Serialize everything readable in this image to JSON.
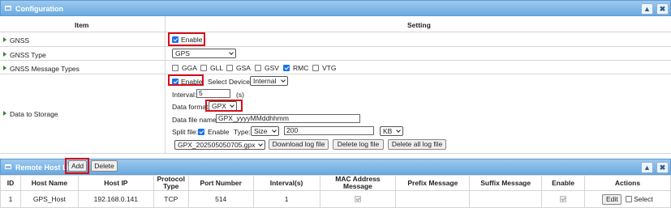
{
  "config": {
    "title": "Configuration",
    "col_item": "Item",
    "col_setting": "Setting",
    "minimize": "▲",
    "close": "✖",
    "gnss": {
      "label": "GNSS",
      "enable_label": "Enable",
      "enabled": true
    },
    "gnss_type": {
      "label": "GNSS Type",
      "value": "GPS"
    },
    "msg_types": {
      "label": "GNSS Message Types",
      "options": [
        {
          "label": "GGA",
          "checked": false
        },
        {
          "label": "GLL",
          "checked": false
        },
        {
          "label": "GSA",
          "checked": false
        },
        {
          "label": "GSV",
          "checked": false
        },
        {
          "label": "RMC",
          "checked": true
        },
        {
          "label": "VTG",
          "checked": false
        }
      ]
    },
    "storage": {
      "label": "Data to Storage",
      "enable_label": "Enable",
      "select_device_label": "Select Device:",
      "device": "Internal",
      "interval_label": "Interval:",
      "interval": "5",
      "interval_unit": "(s)",
      "format_label": "Data format:",
      "format": "GPX",
      "filename_label": "Data file name:",
      "filename": "GPX_yyyyMMddhhmm",
      "split_label": "Split file:",
      "split_enable": "Enable",
      "type_label": "Type:",
      "type": "Size",
      "size": "200",
      "unit": "KB",
      "log_file": "GPX_202505050705.gpx",
      "download_btn": "Download log file",
      "delete_btn": "Delete log file",
      "delete_all_btn": "Delete all log file"
    }
  },
  "remote": {
    "title": "Remote Host List",
    "add_btn": "Add",
    "delete_btn": "Delete",
    "headers": [
      "ID",
      "Host Name",
      "Host IP",
      "Protocol Type",
      "Port Number",
      "Interval(s)",
      "MAC Address Message",
      "Prefix Message",
      "Suffix Message",
      "Enable",
      "Actions"
    ],
    "rows": [
      {
        "id": "1",
        "host_name": "GPS_Host",
        "host_ip": "192.168.0.141",
        "protocol": "TCP",
        "port": "514",
        "interval": "1",
        "mac_msg": true,
        "prefix": "",
        "suffix": "",
        "enable": true,
        "edit": "Edit",
        "select": "Select"
      }
    ]
  }
}
